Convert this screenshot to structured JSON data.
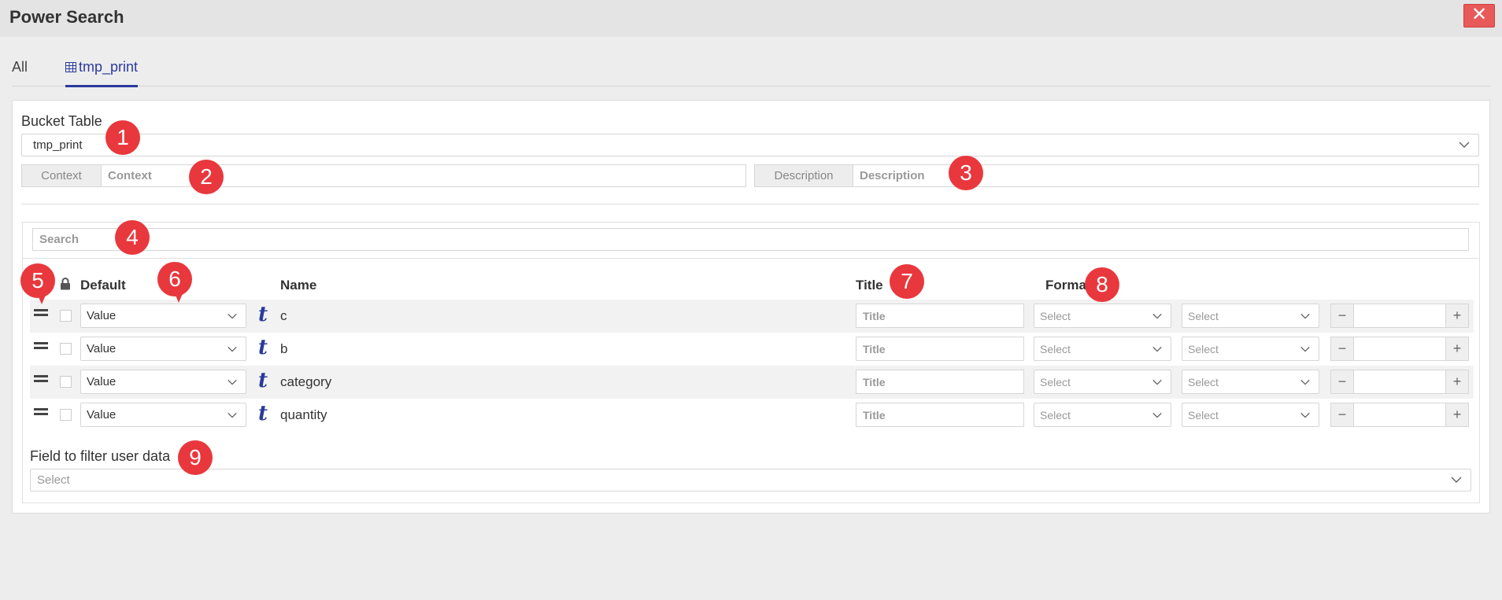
{
  "window": {
    "title": "Power Search",
    "close_glyph": "✕"
  },
  "tabs": [
    {
      "label": "All"
    },
    {
      "label": "tmp_print",
      "icon": "table-icon",
      "active": true
    }
  ],
  "bucket_table": {
    "label": "Bucket Table",
    "value": "tmp_print"
  },
  "context": {
    "addon": "Context",
    "placeholder": "Context"
  },
  "description": {
    "addon": "Description",
    "placeholder": "Description"
  },
  "search": {
    "placeholder": "Search"
  },
  "columns": {
    "default": "Default",
    "name": "Name",
    "title": "Title",
    "format": "Format"
  },
  "fields": [
    {
      "default": "Value",
      "type": "t",
      "name": "c",
      "title_placeholder": "Title",
      "format1": "Select",
      "format2": "Select"
    },
    {
      "default": "Value",
      "type": "t",
      "name": "b",
      "title_placeholder": "Title",
      "format1": "Select",
      "format2": "Select"
    },
    {
      "default": "Value",
      "type": "t",
      "name": "category",
      "title_placeholder": "Title",
      "format1": "Select",
      "format2": "Select"
    },
    {
      "default": "Value",
      "type": "t",
      "name": "quantity",
      "title_placeholder": "Title",
      "format1": "Select",
      "format2": "Select"
    }
  ],
  "stepper": {
    "minus": "−",
    "plus": "+"
  },
  "filter_field": {
    "label": "Field to filter user data",
    "placeholder": "Select"
  },
  "annotations": [
    "1",
    "2",
    "3",
    "4",
    "5",
    "6",
    "7",
    "8",
    "9"
  ],
  "colors": {
    "accent": "#2b3a9c",
    "badge": "#e8383d",
    "close": "#e85a5a"
  }
}
